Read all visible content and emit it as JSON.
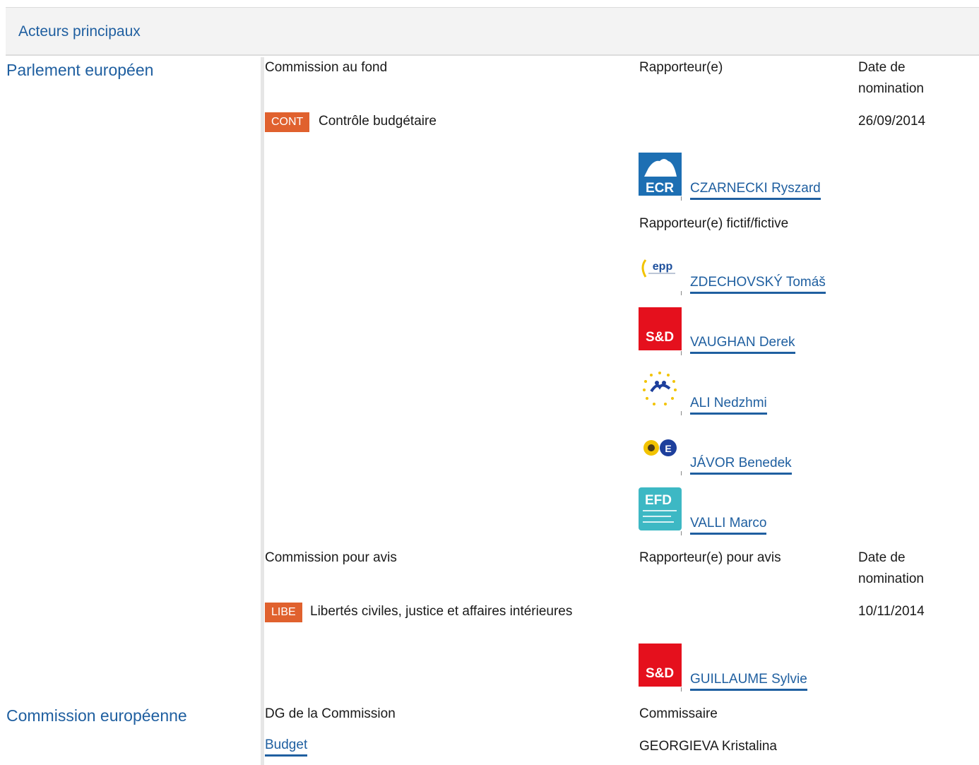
{
  "header": {
    "title": "Acteurs principaux"
  },
  "ep": {
    "label": "Parlement européen",
    "lead_committee_header": "Commission au fond",
    "rapporteur_header": "Rapporteur(e)",
    "date_header": "Date de nomination",
    "lead_committee": {
      "code": "CONT",
      "name": "Contrôle budgétaire",
      "date": "26/09/2014"
    },
    "rapporteurs": [
      {
        "group": "ECR",
        "name": "CZARNECKI Ryszard"
      }
    ],
    "shadow_header": "Rapporteur(e) fictif/fictive",
    "shadows": [
      {
        "group": "EPP",
        "name": "ZDECHOVSKÝ Tomáš"
      },
      {
        "group": "S&D",
        "name": "VAUGHAN Derek"
      },
      {
        "group": "ALDE",
        "name": "ALI Nedzhmi"
      },
      {
        "group": "Greens/EFA",
        "name": "JÁVOR Benedek"
      },
      {
        "group": "EFD",
        "name": "VALLI Marco"
      }
    ],
    "opinion_committee_header": "Commission pour avis",
    "opinion_rapporteur_header": "Rapporteur(e) pour avis",
    "opinion_date_header": "Date de nomination",
    "opinion_committee": {
      "code": "LIBE",
      "name": "Libertés civiles, justice et affaires intérieures",
      "date": "10/11/2014"
    },
    "opinion_rapporteurs": [
      {
        "group": "S&D",
        "name": "GUILLAUME Sylvie"
      }
    ]
  },
  "ec": {
    "label": "Commission européenne",
    "dg_header": "DG de la Commission",
    "commissioner_header": "Commissaire",
    "dg": "Budget",
    "commissioner": "GEORGIEVA Kristalina"
  },
  "colors": {
    "link": "#1f5fa0",
    "badge": "#e0612e",
    "header_bg": "#f3f3f3"
  }
}
